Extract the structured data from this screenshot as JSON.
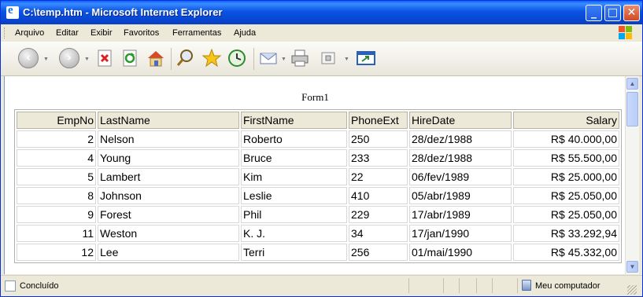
{
  "window": {
    "title": "C:\\temp.htm - Microsoft Internet Explorer"
  },
  "title_buttons": {
    "minimize": "_",
    "maximize": "□",
    "close": "✕"
  },
  "menu": {
    "items": [
      "Arquivo",
      "Editar",
      "Exibir",
      "Favoritos",
      "Ferramentas",
      "Ajuda"
    ]
  },
  "toolbar": {
    "buttons": [
      "back-icon",
      "forward-icon",
      "stop-icon",
      "refresh-icon",
      "home-icon",
      "search-icon",
      "favorites-icon",
      "history-icon",
      "mail-icon",
      "print-icon",
      "edit-icon",
      "messenger-icon"
    ]
  },
  "page": {
    "form_title": "Form1",
    "columns": [
      "EmpNo",
      "LastName",
      "FirstName",
      "PhoneExt",
      "HireDate",
      "Salary"
    ],
    "rows": [
      [
        "2",
        "Nelson",
        "Roberto",
        "250",
        "28/dez/1988",
        "R$ 40.000,00"
      ],
      [
        "4",
        "Young",
        "Bruce",
        "233",
        "28/dez/1988",
        "R$ 55.500,00"
      ],
      [
        "5",
        "Lambert",
        "Kim",
        "22",
        "06/fev/1989",
        "R$ 25.000,00"
      ],
      [
        "8",
        "Johnson",
        "Leslie",
        "410",
        "05/abr/1989",
        "R$ 25.050,00"
      ],
      [
        "9",
        "Forest",
        "Phil",
        "229",
        "17/abr/1989",
        "R$ 25.050,00"
      ],
      [
        "11",
        "Weston",
        "K. J.",
        "34",
        "17/jan/1990",
        "R$ 33.292,94"
      ],
      [
        "12",
        "Lee",
        "Terri",
        "256",
        "01/mai/1990",
        "R$ 45.332,00"
      ]
    ]
  },
  "status": {
    "text": "Concluído",
    "zone": "Meu computador"
  },
  "colors": {
    "title_bar": "#0a53e4",
    "chrome": "#ece9d8",
    "header_cell": "#ece9d8"
  }
}
